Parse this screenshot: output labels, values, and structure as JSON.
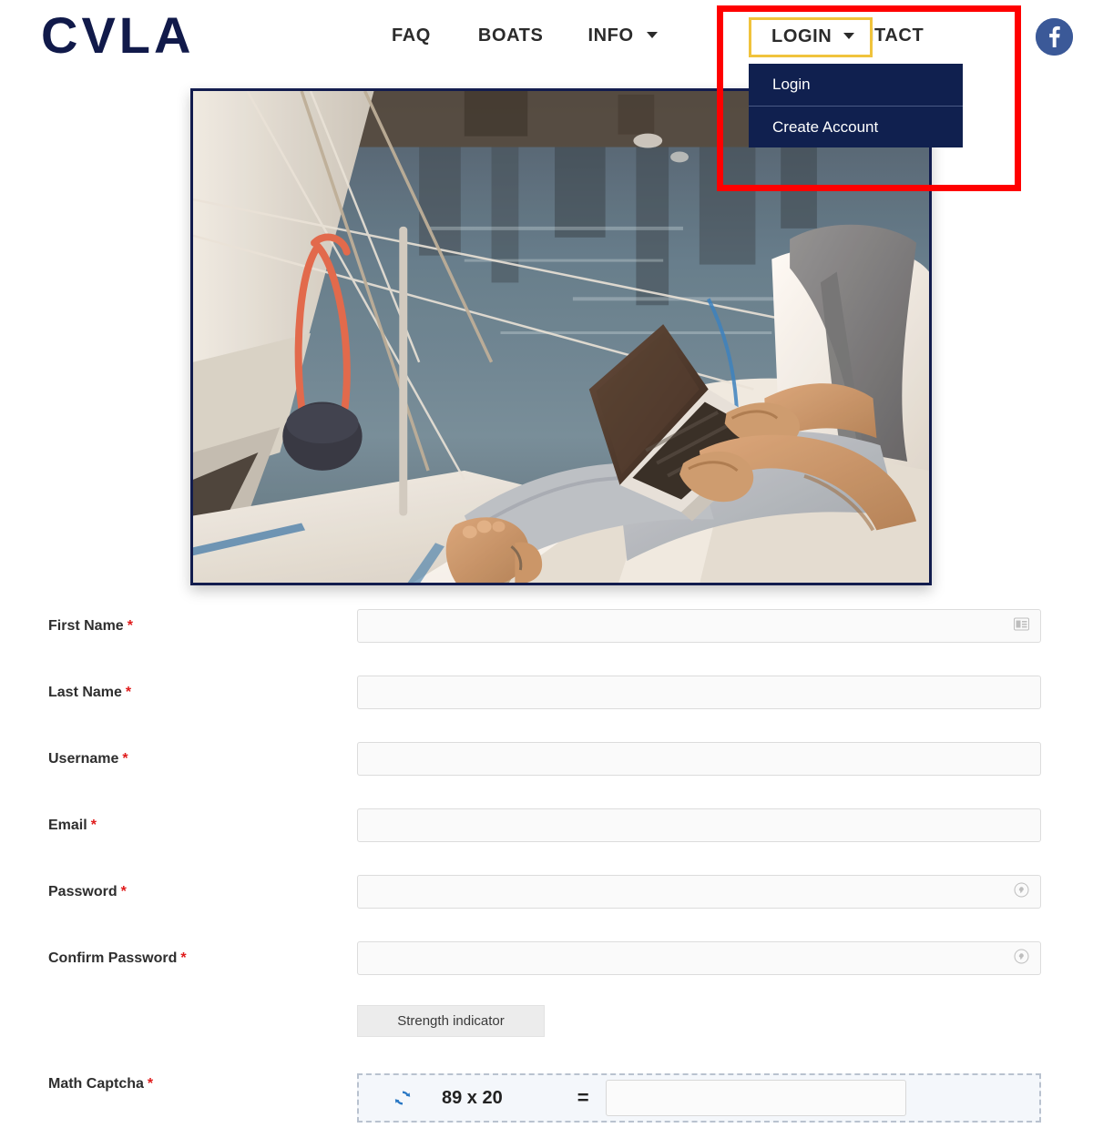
{
  "header": {
    "logo": "CVLA",
    "nav_items": [
      {
        "label": "FAQ",
        "has_caret": false
      },
      {
        "label": "BOATS",
        "has_caret": false
      },
      {
        "label": "INFO",
        "has_caret": true
      },
      {
        "label": "CONTACT",
        "has_caret": false
      }
    ],
    "login": {
      "label": "LOGIN",
      "has_caret": true,
      "highlight_color": "#f0c33c",
      "expanded": true
    },
    "dropdown_items": [
      {
        "label": "Login"
      },
      {
        "label": "Create Account"
      }
    ],
    "social": {
      "name": "facebook",
      "color": "#3b5998"
    }
  },
  "annotation": {
    "color": "#ff0000",
    "shape": "rectangle"
  },
  "hero": {
    "alt": "Man sitting cross-legged on a sailboat deck using a laptop in a harbor",
    "border_color": "#121c4e"
  },
  "form": {
    "fields": [
      {
        "label": "First Name",
        "required": true,
        "value": "",
        "icon": "contact-card-icon"
      },
      {
        "label": "Last Name",
        "required": true,
        "value": "",
        "icon": ""
      },
      {
        "label": "Username",
        "required": true,
        "value": "",
        "icon": ""
      },
      {
        "label": "Email",
        "required": true,
        "value": "",
        "icon": ""
      },
      {
        "label": "Password",
        "required": true,
        "value": "",
        "icon": "key-icon"
      },
      {
        "label": "Confirm Password",
        "required": true,
        "value": "",
        "icon": "key-icon"
      }
    ],
    "required_marker": "*",
    "strength_indicator": "Strength indicator",
    "captcha": {
      "label": "Math Captcha",
      "required": true,
      "problem": "89 x 20",
      "operator": "=",
      "answer_value": "",
      "refresh_color": "#2a78c4"
    }
  }
}
